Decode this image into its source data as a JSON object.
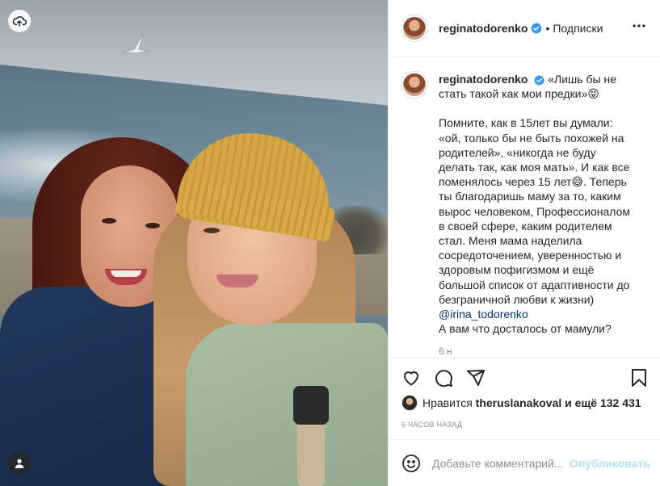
{
  "post": {
    "author": {
      "username": "reginatodorenko",
      "verified": true
    },
    "header": {
      "separator": "•",
      "follow_label": "Подписки"
    },
    "caption": {
      "username": "reginatodorenko",
      "title": "«Лишь бы не стать такой как мои предки»😝",
      "body": "Помните, как в 15лет вы думали: «ой, только бы не быть похожей на родителей», «никогда не буду делать так, как моя мать». И как все поменялось через 15 лет😅. Теперь ты благодаришь маму за то, каким вырос человеком, Профессионалом в своей сфере, каким родителем стал. Меня мама наделила сосредоточением, уверенностью и здоровым пофигизмом и ещё большой список от адаптивности до безграничной любви к жизни)",
      "mention": "@irina_todorenko",
      "footer": "А вам что досталось от мамули?",
      "faded_more": "6 н"
    },
    "likes": {
      "prefix": "Нравится",
      "liker": "theruslanakoval",
      "connector": "и ещё",
      "count": "132 431"
    },
    "timestamp": "6 ЧАСОВ НАЗАД",
    "composer": {
      "placeholder": "Добавьте комментарий...",
      "submit_label": "Опубликовать"
    },
    "icons": {
      "photo_top_left": "cloud-upload-icon",
      "photo_bottom_left": "user-tag-icon",
      "header_more": "more-horizontal-icon",
      "like": "heart-icon",
      "comment": "comment-icon",
      "share": "send-icon",
      "save": "bookmark-icon",
      "emoji": "smiley-icon",
      "verified": "verified-badge-icon"
    },
    "colors": {
      "verified": "#3897f0",
      "publish_disabled": "#b2dffc",
      "mention": "#00376b",
      "muted": "#8e8e8e"
    }
  }
}
